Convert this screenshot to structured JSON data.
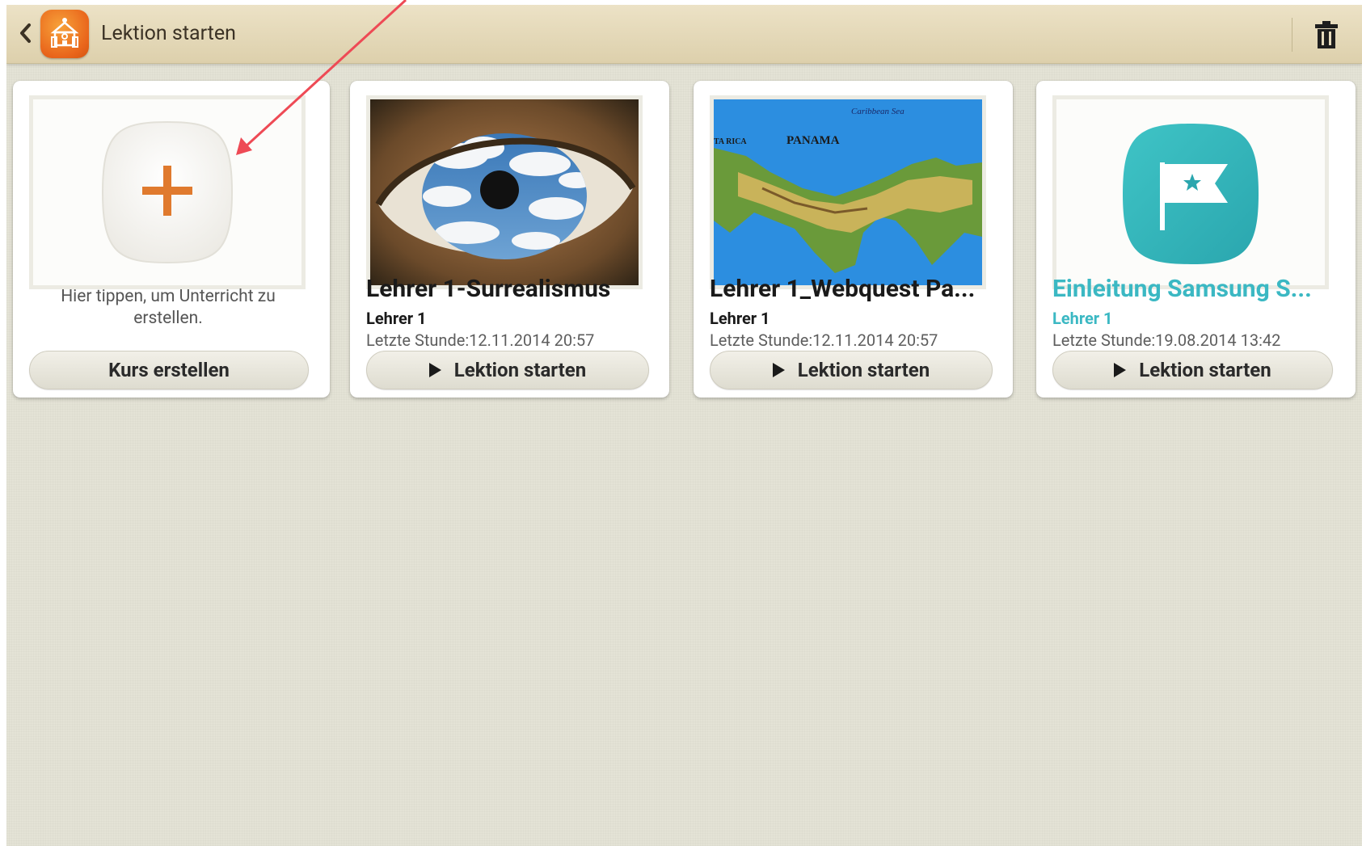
{
  "header": {
    "title": "Lektion starten",
    "back_icon": "chevron-left-icon",
    "app_icon": "classroom-icon",
    "trash_icon": "trash-icon"
  },
  "create_card": {
    "icon": "plus-icon",
    "hint": "Hier tippen, um Unterricht zu erstellen.",
    "button_label": "Kurs erstellen"
  },
  "lessons": [
    {
      "title": "Lehrer 1-Surrealismus",
      "teacher": "Lehrer 1",
      "last_lesson": "Letzte Stunde:12.11.2014 20:57",
      "button_label": "Lektion starten",
      "thumbnail": "surreal-eye-image"
    },
    {
      "title": "Lehrer 1_Webquest Pa...",
      "teacher": "Lehrer 1",
      "last_lesson": "Letzte Stunde:12.11.2014 20:57",
      "button_label": "Lektion starten",
      "thumbnail": "panama-map-image",
      "map_labels": {
        "country": "PANAMA",
        "sea": "Caribbean Sea",
        "neighbor": "TA RICA"
      }
    },
    {
      "title": "Einleitung Samsung S...",
      "teacher": "Lehrer 1",
      "last_lesson": "Letzte Stunde:19.08.2014 13:42",
      "button_label": "Lektion starten",
      "thumbnail": "flag-icon",
      "accent_color": "#3bb8c3"
    }
  ],
  "colors": {
    "topbar": "#e6dbbd",
    "background": "#e4e3d6",
    "accent_teal": "#3bb8c3",
    "plus_orange": "#e07a2e",
    "annotation_arrow": "#ee4a55"
  }
}
